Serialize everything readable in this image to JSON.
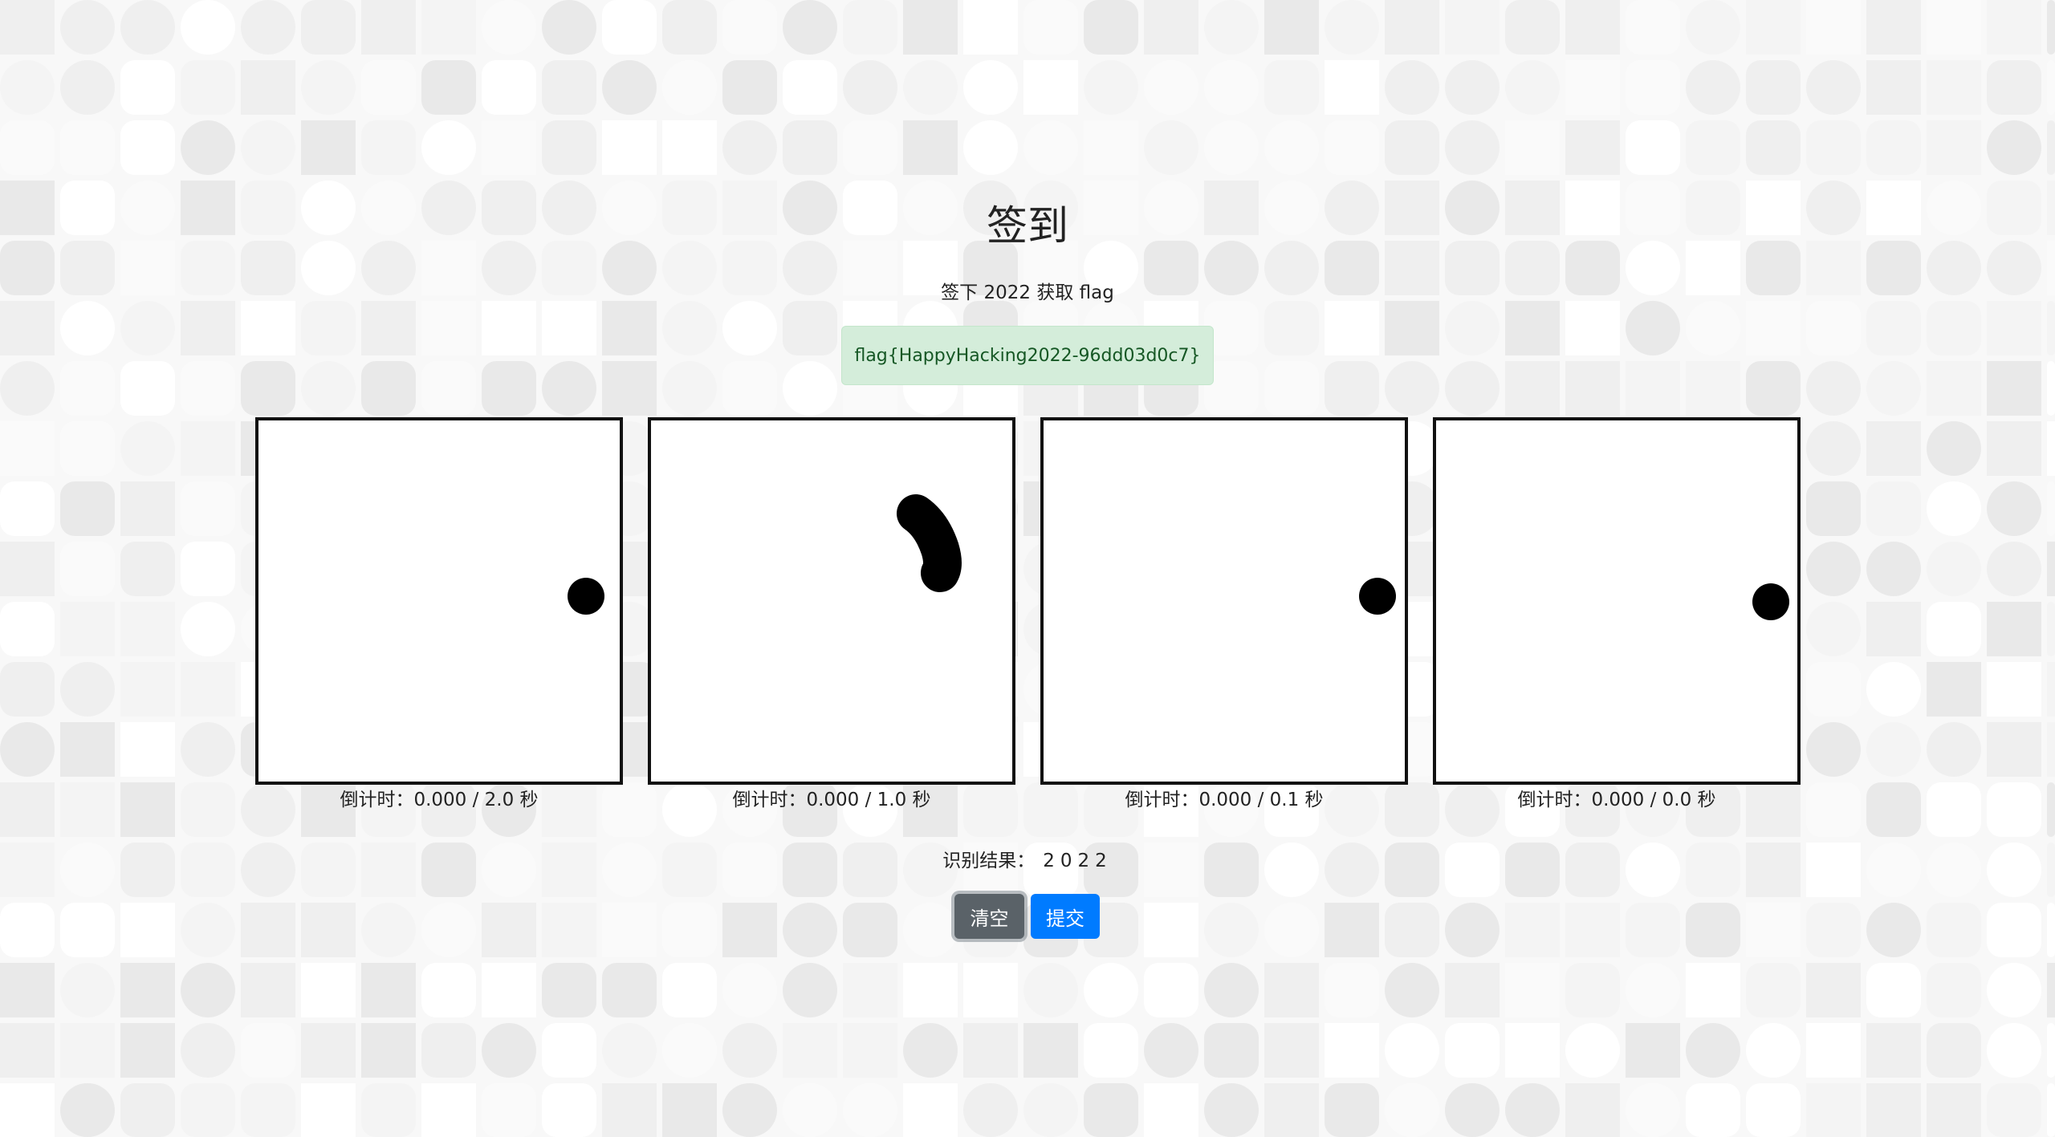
{
  "page": {
    "title": "签到",
    "subtitle": "签下 2022 获取 flag"
  },
  "flag_alert": {
    "text": "flag{HappyHacking2022-96dd03d0c7}"
  },
  "panels": [
    {
      "countdown": "倒计时：0.000 / 2.0 秒"
    },
    {
      "countdown": "倒计时：0.000 / 1.0 秒"
    },
    {
      "countdown": "倒计时：0.000 / 0.1 秒"
    },
    {
      "countdown": "倒计时：0.000 / 0.0 秒"
    }
  ],
  "recognition": {
    "label": "识别结果：",
    "value": "2022"
  },
  "buttons": {
    "clear_label": "清空",
    "submit_label": "提交"
  },
  "colors": {
    "success_bg": "#d4edda",
    "success_text": "#155724",
    "primary": "#007bff",
    "secondary": "#5a6268"
  }
}
